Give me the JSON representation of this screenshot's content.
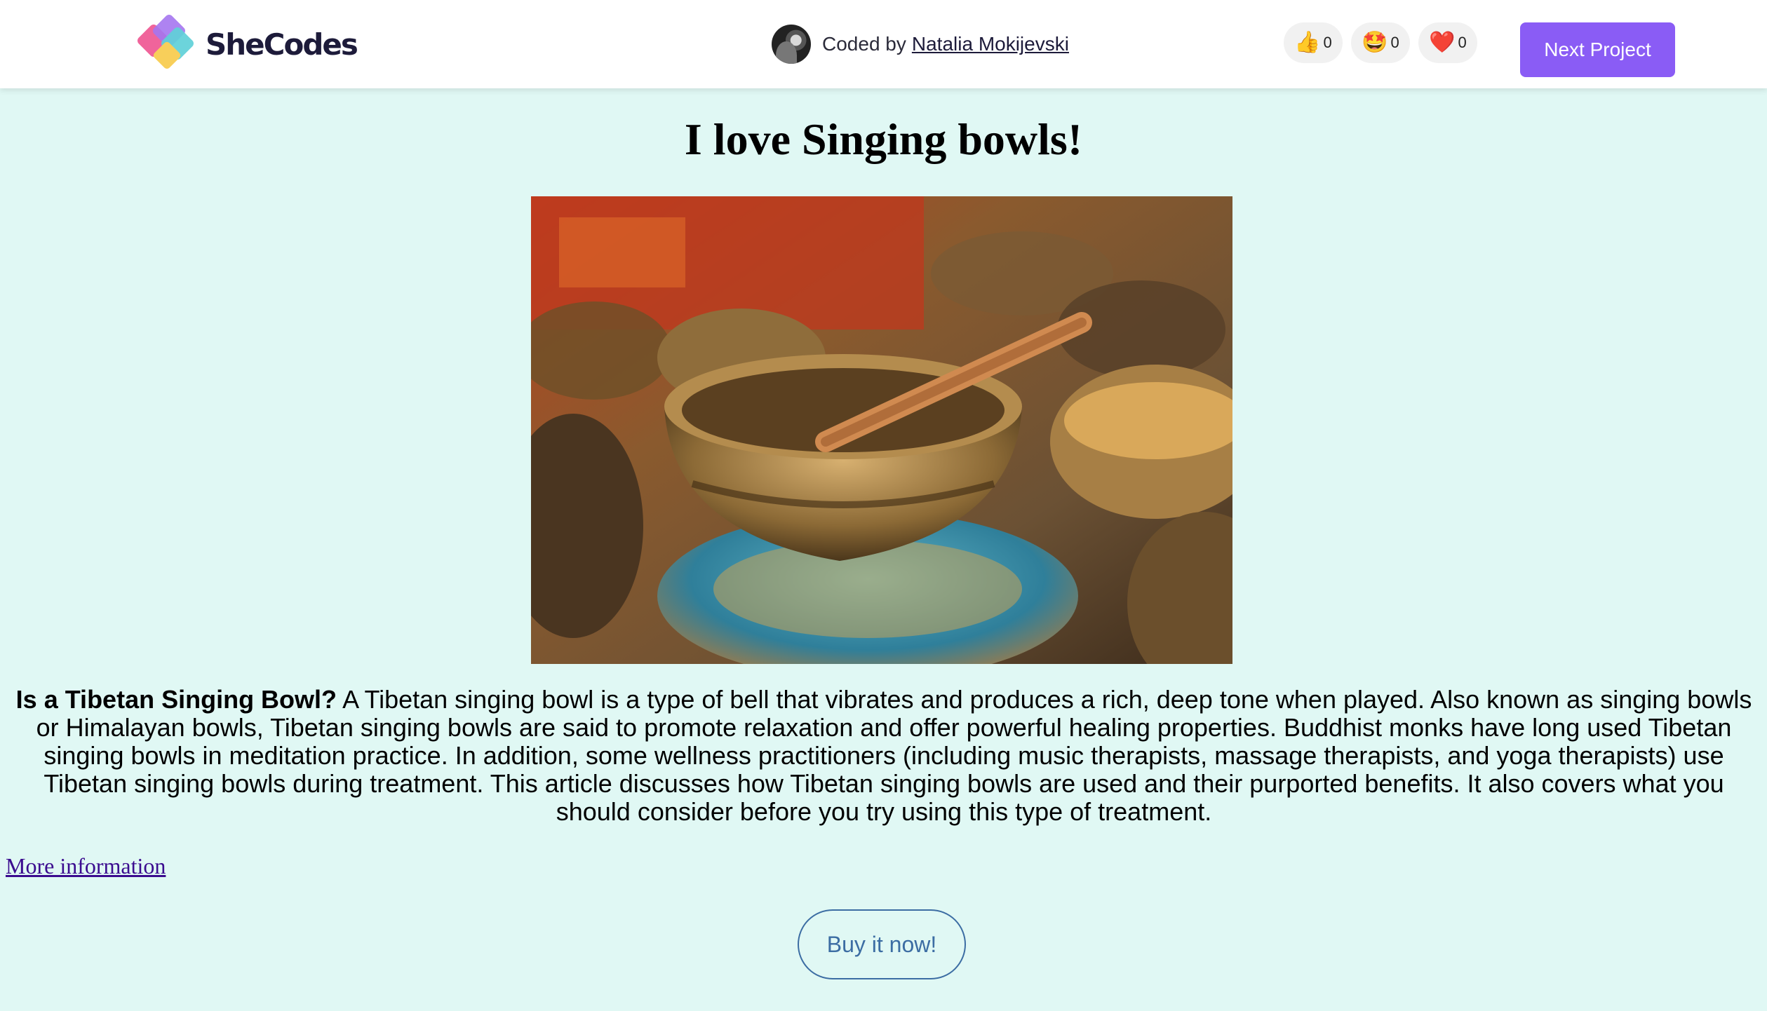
{
  "header": {
    "logo_text": "SheCodes",
    "coded_by_prefix": "Coded by",
    "author_name": "Natalia Mokijevski",
    "reactions": [
      {
        "icon": "thumbs-up-icon",
        "emoji": "👍",
        "count": "0"
      },
      {
        "icon": "star-struck-icon",
        "emoji": "🤩",
        "count": "0"
      },
      {
        "icon": "heart-icon",
        "emoji": "❤️",
        "count": "0"
      }
    ],
    "next_button": "Next Project"
  },
  "page": {
    "title": "I love Singing bowls!",
    "image_alt": "singing bowl",
    "article_lead": "Is a Tibetan Singing Bowl?",
    "article_body": " A Tibetan singing bowl is a type of bell that vibrates and produces a rich, deep tone when played. Also known as singing bowls or Himalayan bowls, Tibetan singing bowls are said to promote relaxation and offer powerful healing properties. Buddhist monks have long used Tibetan singing bowls in meditation practice. In addition, some wellness practitioners (including music therapists, massage therapists, and yoga therapists) use Tibetan singing bowls during treatment. This article discusses how Tibetan singing bowls are used and their purported benefits. It also covers what you should consider before you try using this type of treatment.",
    "more_link": "More information",
    "buy_button": "Buy it now!"
  },
  "colors": {
    "background": "#e0f8f4",
    "accent": "#8a5cf5",
    "buy_button": "#3c6da3",
    "link": "#3b0c8f"
  }
}
